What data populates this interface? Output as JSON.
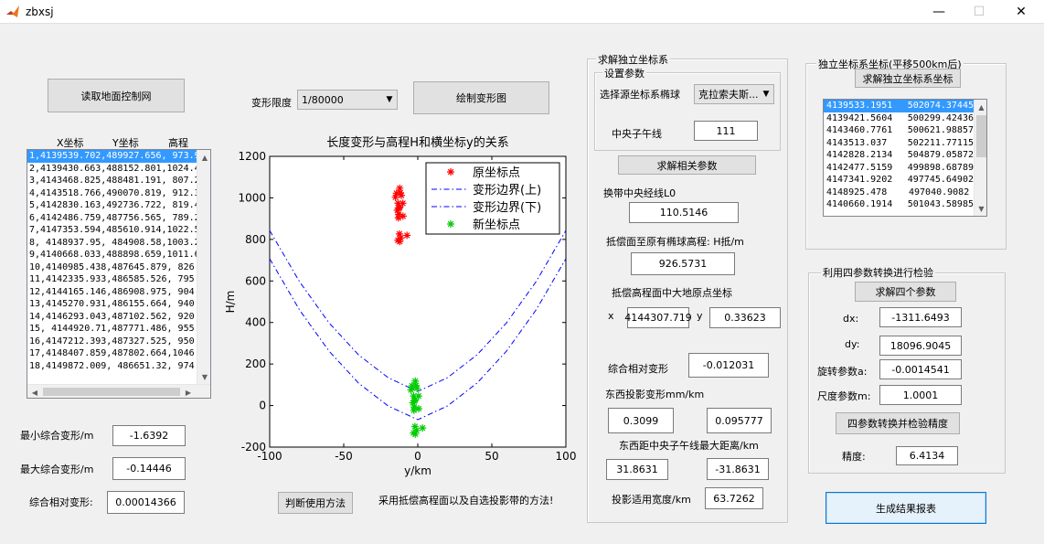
{
  "window": {
    "title": "zbxsj",
    "minimize": "—",
    "maximize": "☐",
    "close": "✕"
  },
  "left": {
    "read_button": "读取地面控制网",
    "columns": [
      "X坐标",
      "Y坐标",
      "高程"
    ],
    "rows": [
      "1,4139539.702,489927.656, 973.988",
      "2,4139430.663,488152.801,1024.436",
      "3,4143468.825,488481.191, 807.219",
      "4,4143518.766,490070.819, 912.334",
      "5,4142830.163,492736.722, 819.466",
      "6,4142486.759,487756.565, 789.203",
      "7,4147353.594,485610.914,1022.58",
      "8, 4148937.95, 484908.58,1003.243",
      "9,4140668.033,488898.659,1011.685",
      "10,4140985.438,487645.879, 826.194",
      "11,4142335.933,486585.526, 795.573",
      "12,4144165.146,486908.975, 904.026",
      "13,4145270.931,486155.664, 940.909",
      "14,4146293.043,487102.562, 920.955",
      "15, 4144920.71,487771.486, 955.128",
      "16,4147212.393,487327.525, 950.256",
      "17,4148407.859,487802.664,1046.674",
      "18,4149872.009, 486651.32, 974.447"
    ],
    "min_label": "最小综合变形/m",
    "min_value": "-1.6392",
    "max_label": "最大综合变形/m",
    "max_value": "-0.14446",
    "rel_label": "综合相对变形:",
    "rel_value": "0.00014366"
  },
  "middle": {
    "limit_label": "变形限度",
    "limit_value": "1/80000",
    "draw_button": "绘制变形图",
    "judge_button": "判断使用方法",
    "method_text": "采用抵偿高程面以及自选投影带的方法!"
  },
  "chart_data": {
    "type": "scatter",
    "title": "长度变形与高程H和横坐标y的关系",
    "xlabel": "y/km",
    "ylabel": "H/m",
    "xlim": [
      -100,
      100
    ],
    "ylim": [
      -200,
      1200
    ],
    "xticks": [
      "-100",
      "-50",
      "0",
      "50",
      "100"
    ],
    "yticks": [
      "-200",
      "0",
      "200",
      "400",
      "600",
      "800",
      "1000",
      "1200"
    ],
    "legend_position": "top-right",
    "series": [
      {
        "name": "原坐标点",
        "color": "#ff0000",
        "marker": "*",
        "x": [
          -10.1,
          -11.8,
          -11.5,
          -10.0,
          -7.3,
          -12.2,
          -14.4,
          -15.1,
          -11.1,
          -12.4,
          -13.4,
          -13.1,
          -13.8,
          -12.9,
          -12.2,
          -12.7,
          -12.2,
          -13.3
        ],
        "y": [
          974.0,
          1024.4,
          807.2,
          912.3,
          819.5,
          789.2,
          1022.6,
          1003.2,
          1011.7,
          826.2,
          795.6,
          904.0,
          940.9,
          921.0,
          955.1,
          950.3,
          1046.7,
          974.4
        ]
      },
      {
        "name": "变形边界(上)",
        "color": "#0000ff",
        "marker": "dashdot",
        "x": [
          -100,
          -80,
          -60,
          -40,
          -20,
          0,
          20,
          40,
          60,
          80,
          100
        ],
        "y": [
          843,
          598,
          399,
          244,
          134,
          68,
          134,
          244,
          399,
          598,
          843
        ]
      },
      {
        "name": "变形边界(下)",
        "color": "#0000ff",
        "marker": "dashdot",
        "x": [
          -100,
          -80,
          -60,
          -40,
          -20,
          0,
          20,
          40,
          60,
          80,
          100
        ],
        "y": [
          707,
          462,
          263,
          108,
          -2,
          -68,
          -2,
          108,
          263,
          462,
          707
        ]
      },
      {
        "name": "新坐标点",
        "color": "#00cc00",
        "marker": "*",
        "x": [
          0.5,
          -1.2,
          -0.8,
          0.6,
          3.2,
          -1.7,
          -3.9,
          -4.6,
          -0.6,
          -1.9,
          -2.9,
          -2.6,
          -3.3,
          -2.4,
          -1.7,
          -2.2,
          -1.7,
          -2.8
        ],
        "y": [
          46,
          96,
          -120,
          -15,
          -108,
          -138,
          95,
          75,
          83,
          -101,
          -132,
          -23,
          13,
          -7,
          27,
          22,
          118,
          46
        ]
      }
    ]
  },
  "independent": {
    "panel_title": "求解独立坐标系",
    "params_title": "设置参数",
    "ellipsoid_label": "选择源坐标系椭球",
    "ellipsoid_value": "克拉索夫斯...",
    "meridian_label": "中央子午线",
    "meridian_value": "111",
    "solve_button": "求解相关参数",
    "l0_label": "换带中央经线L0",
    "l0_value": "110.5146",
    "h_label": "抵偿面至原有椭球高程: H抵/m",
    "h_value": "926.5731",
    "origin_label": "抵偿高程面中大地原点坐标",
    "x_label": "x",
    "x_value": "4144307.719",
    "y_label": "y",
    "y_value": "0.33623",
    "rel_label": "综合相对变形",
    "rel_value": "-0.012031",
    "ew_label": "东西投影变形mm/km",
    "ew_value1": "0.3099",
    "ew_value2": "0.095777",
    "dist_label": "东西距中央子午线最大距离/km",
    "dist_value1": "31.8631",
    "dist_value2": "-31.8631",
    "width_label": "投影适用宽度/km",
    "width_value": "63.7262"
  },
  "right": {
    "panel_title": "独立坐标系坐标(平移500km后)",
    "solve_button": "求解独立坐标系坐标",
    "rows": [
      [
        "4139533.1951",
        "502074.37445"
      ],
      [
        "4139421.5604",
        "500299.42436"
      ],
      [
        "4143460.7761",
        "500621.98857"
      ],
      [
        "4143513.037",
        "502211.77115"
      ],
      [
        "4142828.2134",
        "504879.05872"
      ],
      [
        "4142477.5159",
        "499898.68789"
      ],
      [
        "4147341.9202",
        "497745.64902"
      ],
      [
        "4148925.478",
        "497040.9082"
      ],
      [
        "4140660.1914",
        "501043.58985"
      ]
    ],
    "check_title": "利用四参数转换进行检验",
    "four_button": "求解四个参数",
    "dx_label": "dx:",
    "dx_value": "-1311.6493",
    "dy_label": "dy:",
    "dy_value": "18096.9045",
    "rot_label": "旋转参数a:",
    "rot_value": "-0.0014541",
    "scale_label": "尺度参数m:",
    "scale_value": "1.0001",
    "convert_button": "四参数转换并检验精度",
    "acc_label": "精度:",
    "acc_value": "6.4134",
    "report_button": "生成结果报表"
  }
}
